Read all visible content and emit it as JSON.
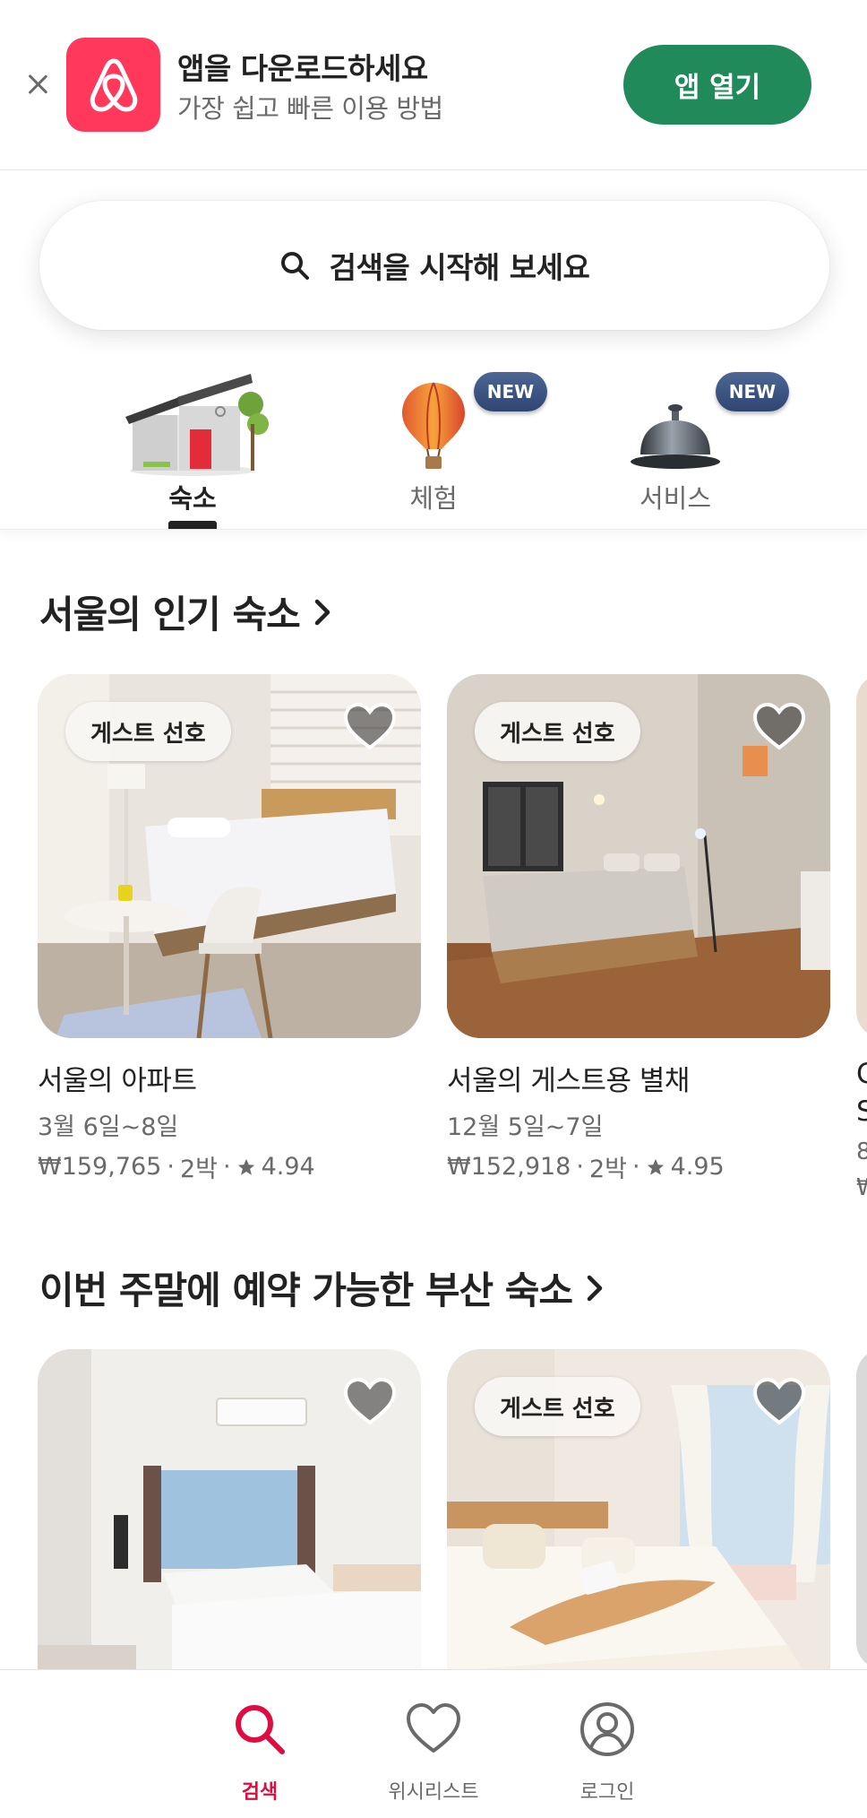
{
  "banner": {
    "title": "앱을 다운로드하세요",
    "subtitle": "가장 쉽고 빠른 이용 방법",
    "open_button": "앱 열기",
    "close_icon": "close-icon",
    "logo_icon": "airbnb-logo-icon",
    "button_color": "#218a5b",
    "logo_color": "#ff385c"
  },
  "search": {
    "placeholder": "검색을 시작해 보세요",
    "icon": "search-icon"
  },
  "categories": [
    {
      "label": "숙소",
      "icon": "house-icon",
      "active": true,
      "badge": ""
    },
    {
      "label": "체험",
      "icon": "hot-air-balloon-icon",
      "active": false,
      "badge": "NEW"
    },
    {
      "label": "서비스",
      "icon": "service-bell-icon",
      "active": false,
      "badge": "NEW"
    }
  ],
  "sections": [
    {
      "title": "서울의 인기 숙소",
      "cards": [
        {
          "badge": "게스트 선호",
          "name": "서울의 아파트",
          "dates": "3월 6일~8일",
          "price": "₩159,765",
          "nights": "2박",
          "rating": "4.94"
        },
        {
          "badge": "게스트 선호",
          "name": "서울의 게스트용 별채",
          "dates": "12월 5일~7일",
          "price": "₩152,918",
          "nights": "2박",
          "rating": "4.95"
        }
      ],
      "partial": {
        "line1": "C",
        "line2": "S",
        "line3": "8",
        "line4": "₩"
      }
    },
    {
      "title": "이번 주말에 예약 가능한 부산 숙소",
      "cards": [
        {
          "badge": ""
        },
        {
          "badge": "게스트 선호"
        }
      ]
    }
  ],
  "bottom_nav": [
    {
      "label": "검색",
      "icon": "search-icon",
      "active": true
    },
    {
      "label": "위시리스트",
      "icon": "heart-icon",
      "active": false
    },
    {
      "label": "로그인",
      "icon": "user-circle-icon",
      "active": false
    }
  ],
  "colors": {
    "accent": "#e00b41",
    "text": "#222222",
    "muted": "#6a6a6a"
  }
}
